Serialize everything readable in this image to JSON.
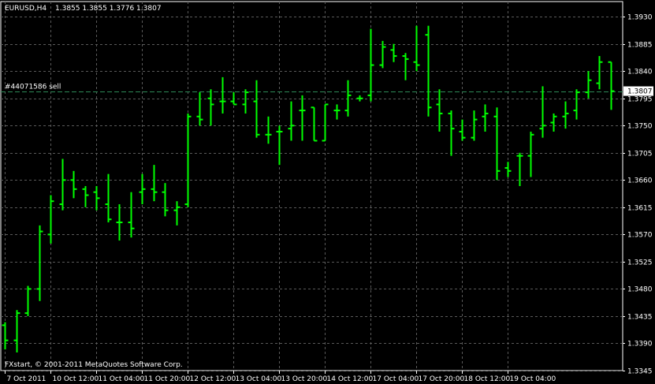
{
  "header": {
    "symbol": "EURUSD,H4",
    "ohlc": "1.3855 1.3855 1.3776 1.3807"
  },
  "order_line": {
    "label": "#44071586 sell",
    "price": 1.3807
  },
  "current_price": {
    "label": "1.3807",
    "value": 1.3807
  },
  "copyright": "FXstart, © 2001-2011 MetaQuotes Software Corp.",
  "colors": {
    "background": "#000000",
    "bars": "#00ff00",
    "grid": "#5a5a5a",
    "order_line": "#2e8b57",
    "text": "#ffffff",
    "price_box": "#ffffff"
  },
  "chart_data": {
    "type": "ohlc",
    "ylim": [
      1.3345,
      1.3955
    ],
    "grid": true,
    "y_ticks": [
      "1.3930",
      "1.3885",
      "1.3840",
      "1.3795",
      "1.3750",
      "1.3705",
      "1.3660",
      "1.3615",
      "1.3570",
      "1.3525",
      "1.3480",
      "1.3435",
      "1.3390",
      "1.3345"
    ],
    "x_ticks": [
      {
        "index": 0,
        "label": "7 Oct 2011"
      },
      {
        "index": 4,
        "label": "10 Oct 12:00"
      },
      {
        "index": 8,
        "label": "11 Oct 04:00"
      },
      {
        "index": 12,
        "label": "11 Oct 20:00"
      },
      {
        "index": 16,
        "label": "12 Oct 12:00"
      },
      {
        "index": 20,
        "label": "13 Oct 04:00"
      },
      {
        "index": 24,
        "label": "13 Oct 20:00"
      },
      {
        "index": 28,
        "label": "14 Oct 12:00"
      },
      {
        "index": 32,
        "label": "17 Oct 04:00"
      },
      {
        "index": 36,
        "label": "17 Oct 20:00"
      },
      {
        "index": 40,
        "label": "18 Oct 12:00"
      },
      {
        "index": 44,
        "label": "19 Oct 04:00"
      }
    ],
    "bars": [
      {
        "o": 1.342,
        "h": 1.3425,
        "l": 1.338,
        "c": 1.3395
      },
      {
        "o": 1.3395,
        "h": 1.3445,
        "l": 1.3375,
        "c": 1.344
      },
      {
        "o": 1.344,
        "h": 1.3485,
        "l": 1.3435,
        "c": 1.348
      },
      {
        "o": 1.348,
        "h": 1.3585,
        "l": 1.346,
        "c": 1.3575
      },
      {
        "o": 1.357,
        "h": 1.3635,
        "l": 1.3555,
        "c": 1.3625
      },
      {
        "o": 1.362,
        "h": 1.3695,
        "l": 1.361,
        "c": 1.366
      },
      {
        "o": 1.366,
        "h": 1.3675,
        "l": 1.363,
        "c": 1.3645
      },
      {
        "o": 1.3645,
        "h": 1.365,
        "l": 1.3615,
        "c": 1.3635
      },
      {
        "o": 1.364,
        "h": 1.365,
        "l": 1.361,
        "c": 1.363
      },
      {
        "o": 1.362,
        "h": 1.367,
        "l": 1.359,
        "c": 1.3595
      },
      {
        "o": 1.359,
        "h": 1.362,
        "l": 1.356,
        "c": 1.359
      },
      {
        "o": 1.359,
        "h": 1.364,
        "l": 1.3565,
        "c": 1.358
      },
      {
        "o": 1.364,
        "h": 1.367,
        "l": 1.362,
        "c": 1.3645
      },
      {
        "o": 1.3645,
        "h": 1.3685,
        "l": 1.3625,
        "c": 1.364
      },
      {
        "o": 1.364,
        "h": 1.3655,
        "l": 1.36,
        "c": 1.361
      },
      {
        "o": 1.361,
        "h": 1.3625,
        "l": 1.3585,
        "c": 1.3615
      },
      {
        "o": 1.362,
        "h": 1.377,
        "l": 1.3615,
        "c": 1.3765
      },
      {
        "o": 1.3765,
        "h": 1.3805,
        "l": 1.375,
        "c": 1.376
      },
      {
        "o": 1.3795,
        "h": 1.381,
        "l": 1.375,
        "c": 1.3785
      },
      {
        "o": 1.379,
        "h": 1.383,
        "l": 1.377,
        "c": 1.379
      },
      {
        "o": 1.379,
        "h": 1.3805,
        "l": 1.3785,
        "c": 1.3785
      },
      {
        "o": 1.3785,
        "h": 1.381,
        "l": 1.377,
        "c": 1.3805
      },
      {
        "o": 1.379,
        "h": 1.3825,
        "l": 1.373,
        "c": 1.3735
      },
      {
        "o": 1.3735,
        "h": 1.3765,
        "l": 1.372,
        "c": 1.3735
      },
      {
        "o": 1.374,
        "h": 1.375,
        "l": 1.3685,
        "c": 1.374
      },
      {
        "o": 1.3745,
        "h": 1.379,
        "l": 1.3725,
        "c": 1.375
      },
      {
        "o": 1.3775,
        "h": 1.38,
        "l": 1.3725,
        "c": 1.3775
      },
      {
        "o": 1.378,
        "h": 1.378,
        "l": 1.3725,
        "c": 1.3725
      },
      {
        "o": 1.3725,
        "h": 1.3785,
        "l": 1.3725,
        "c": 1.3785
      },
      {
        "o": 1.3775,
        "h": 1.3785,
        "l": 1.376,
        "c": 1.3775
      },
      {
        "o": 1.3775,
        "h": 1.3825,
        "l": 1.3765,
        "c": 1.38
      },
      {
        "o": 1.3795,
        "h": 1.38,
        "l": 1.379,
        "c": 1.3795
      },
      {
        "o": 1.38,
        "h": 1.391,
        "l": 1.379,
        "c": 1.385
      },
      {
        "o": 1.385,
        "h": 1.389,
        "l": 1.3845,
        "c": 1.388
      },
      {
        "o": 1.3875,
        "h": 1.3885,
        "l": 1.3855,
        "c": 1.3865
      },
      {
        "o": 1.3865,
        "h": 1.387,
        "l": 1.3825,
        "c": 1.386
      },
      {
        "o": 1.3855,
        "h": 1.3915,
        "l": 1.384,
        "c": 1.385
      },
      {
        "o": 1.39,
        "h": 1.3915,
        "l": 1.3765,
        "c": 1.378
      },
      {
        "o": 1.3785,
        "h": 1.381,
        "l": 1.374,
        "c": 1.377
      },
      {
        "o": 1.377,
        "h": 1.3775,
        "l": 1.37,
        "c": 1.3745
      },
      {
        "o": 1.374,
        "h": 1.376,
        "l": 1.3725,
        "c": 1.373
      },
      {
        "o": 1.373,
        "h": 1.3775,
        "l": 1.3725,
        "c": 1.376
      },
      {
        "o": 1.3765,
        "h": 1.3785,
        "l": 1.374,
        "c": 1.377
      },
      {
        "o": 1.3765,
        "h": 1.378,
        "l": 1.366,
        "c": 1.3675
      },
      {
        "o": 1.368,
        "h": 1.369,
        "l": 1.3665,
        "c": 1.3675
      },
      {
        "o": 1.37,
        "h": 1.3705,
        "l": 1.365,
        "c": 1.37
      },
      {
        "o": 1.37,
        "h": 1.374,
        "l": 1.3665,
        "c": 1.3735
      },
      {
        "o": 1.3745,
        "h": 1.3815,
        "l": 1.373,
        "c": 1.375
      },
      {
        "o": 1.3755,
        "h": 1.377,
        "l": 1.374,
        "c": 1.3765
      },
      {
        "o": 1.3765,
        "h": 1.379,
        "l": 1.3745,
        "c": 1.377
      },
      {
        "o": 1.3775,
        "h": 1.381,
        "l": 1.376,
        "c": 1.3805
      },
      {
        "o": 1.3805,
        "h": 1.384,
        "l": 1.3795,
        "c": 1.3825
      },
      {
        "o": 1.382,
        "h": 1.3865,
        "l": 1.381,
        "c": 1.3855
      },
      {
        "o": 1.3855,
        "h": 1.3855,
        "l": 1.3776,
        "c": 1.3807
      }
    ]
  }
}
